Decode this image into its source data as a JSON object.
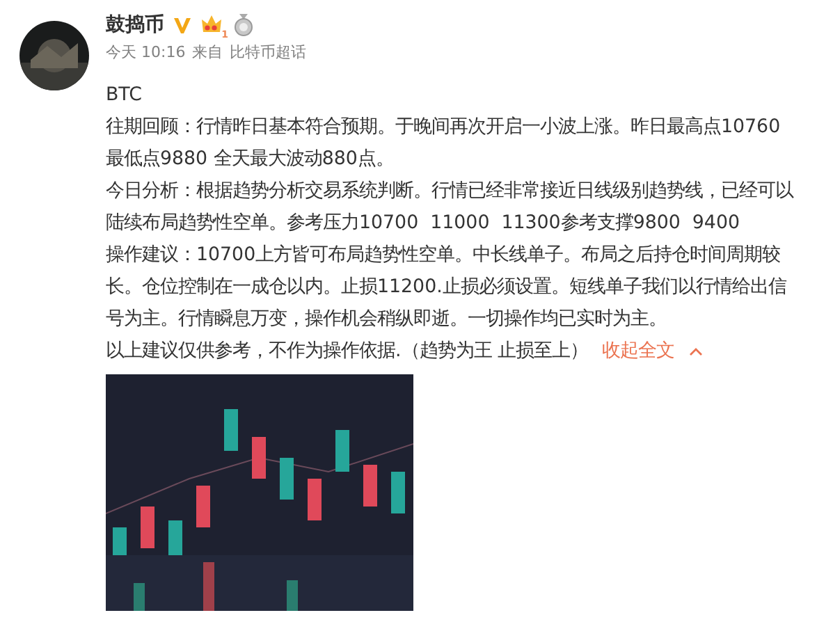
{
  "author": {
    "name": "鼓捣币",
    "crown_level": "1"
  },
  "meta": {
    "time": "今天 10:16",
    "from": "来自",
    "source": "比特币超话"
  },
  "paragraphs": [
    "BTC",
    "往期回顾：行情昨日基本符合预期。于晚间再次开启一小波上涨。昨日最高点10760  最低点9880 全天最大波动880点。",
    "今日分析：根据趋势分析交易系统判断。行情已经非常接近日线级别趋势线，已经可以陆续布局趋势性空单。参考压力10700  11000  11300参考支撑9800  9400",
    "操作建议：10700上方皆可布局趋势性空单。中长线单子。布局之后持仓时间周期较长。仓位控制在一成仓以内。止损11200.止损必须设置。短线单子我们以行情给出信号为主。行情瞬息万变，操作机会稍纵即逝。一切操作均已实时为主。",
    "以上建议仅供参考，不作为操作依据.（趋势为王  止损至上）"
  ],
  "collapse_link": "收起全文"
}
